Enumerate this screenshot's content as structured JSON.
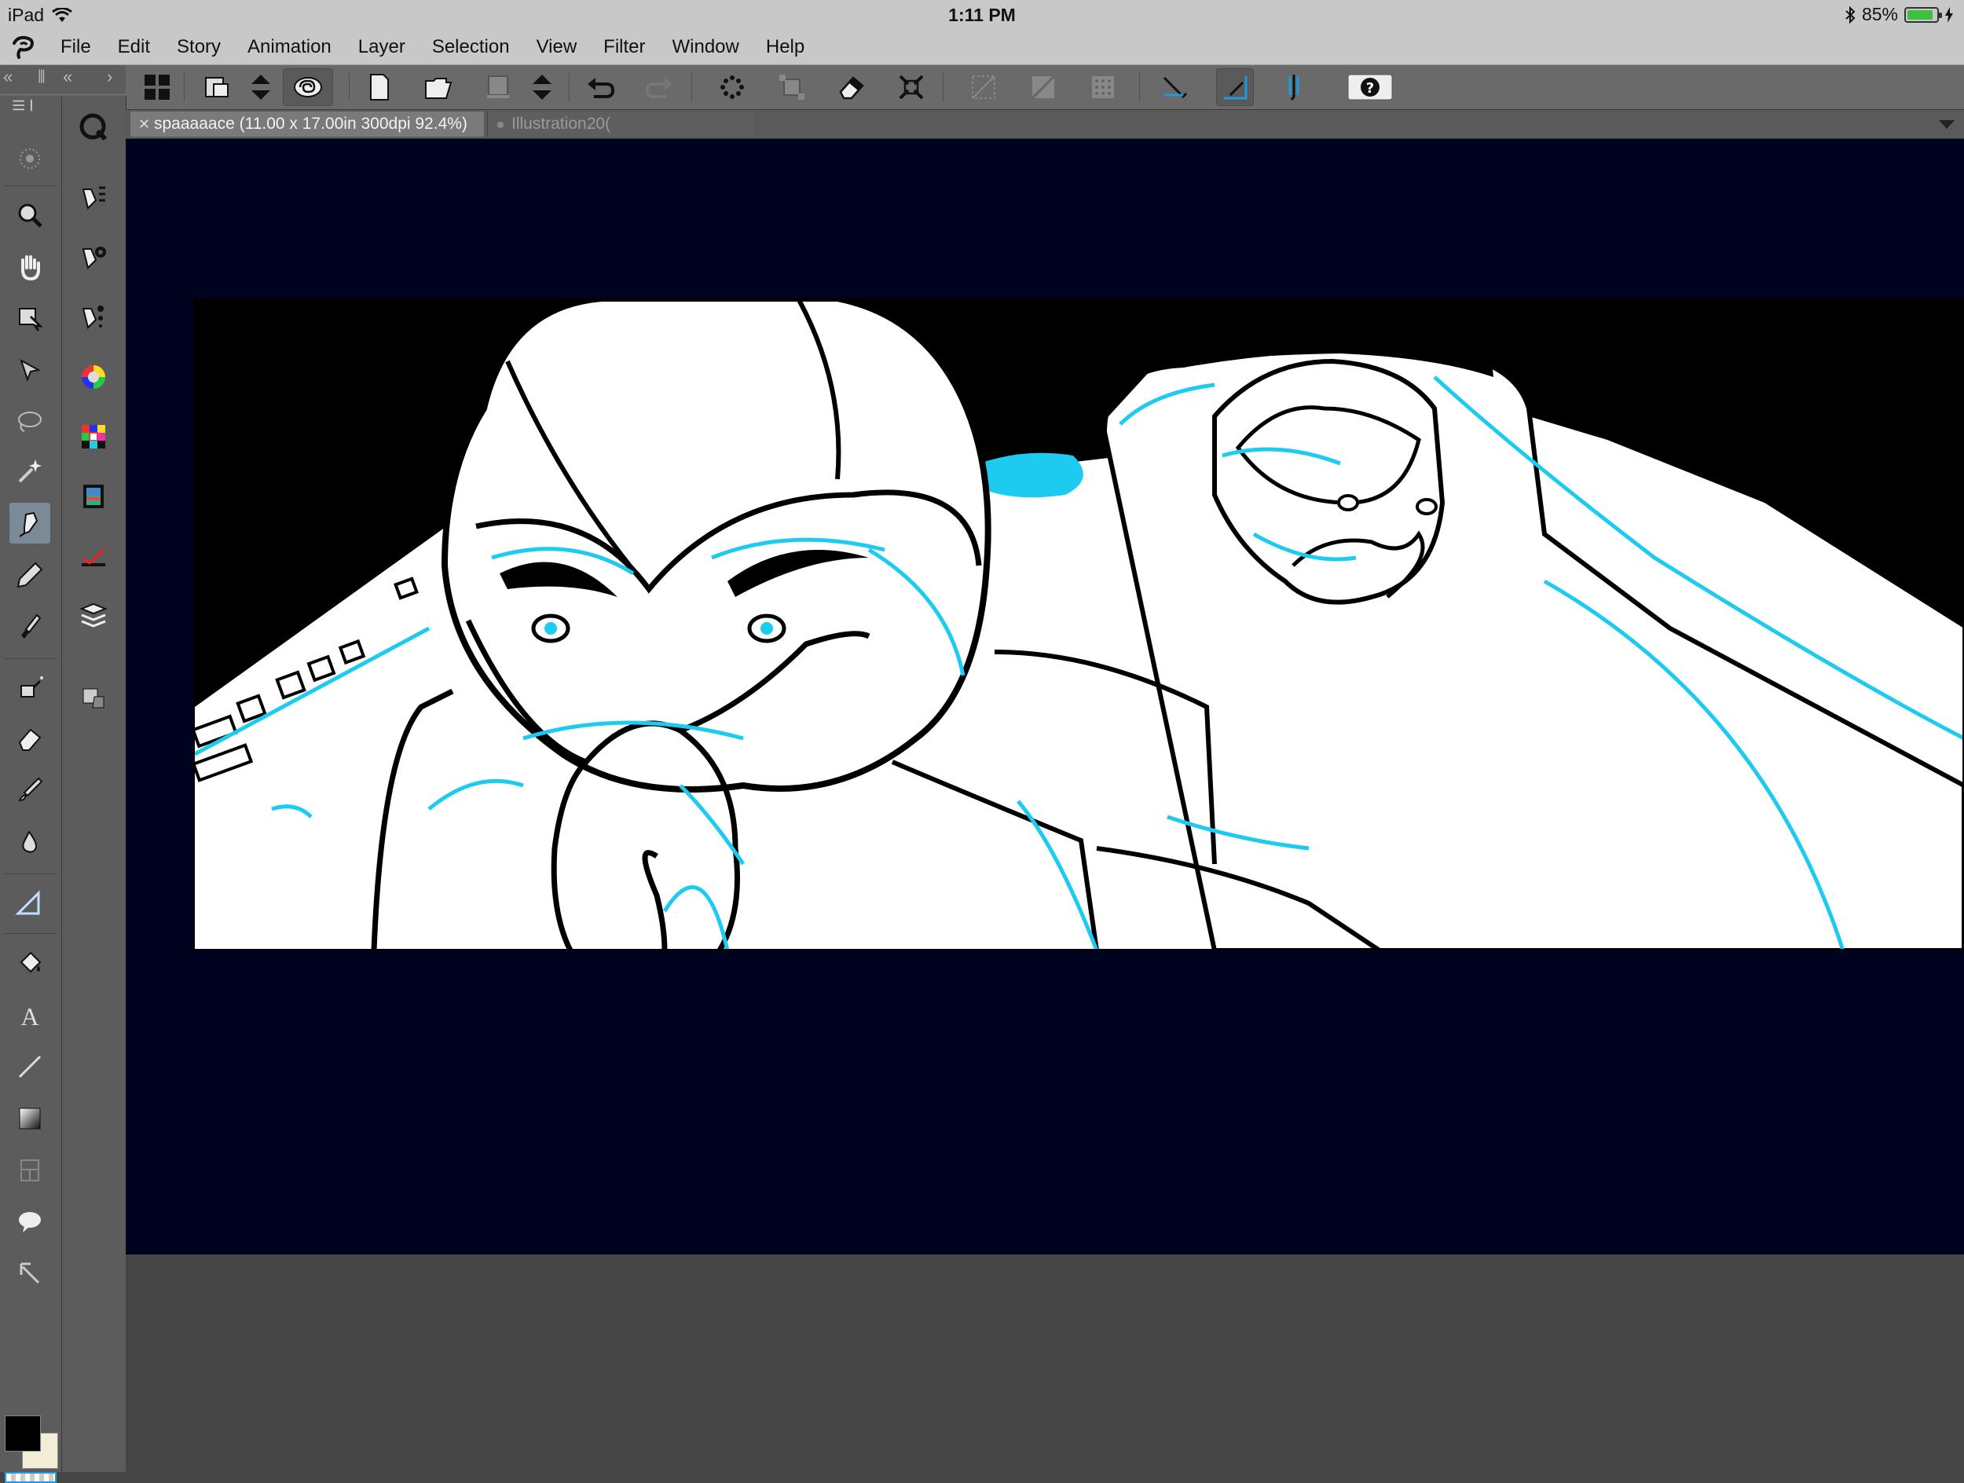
{
  "status_bar": {
    "device": "iPad",
    "time": "1:11 PM",
    "battery": "85%",
    "battery_level": 0.85
  },
  "menu": {
    "items": [
      "File",
      "Edit",
      "Story",
      "Animation",
      "Layer",
      "Selection",
      "View",
      "Filter",
      "Window",
      "Help"
    ]
  },
  "tabs": {
    "active": "spaaaaace (11.00 x 17.00in 300dpi 92.4%)",
    "inactive": "Illustration20("
  },
  "colors": {
    "canvas_bg": "#00031f",
    "accent_line": "#1ecbf0",
    "main_color": "#000000",
    "sub_color": "#f3ecd6"
  },
  "toolbar_icons": [
    "grid-icon",
    "save-as-icon",
    "up-down-icon",
    "swirl-icon",
    "new-doc-icon",
    "open-folder-icon",
    "layer-icon",
    "up-down-icon",
    "undo-icon",
    "redo-icon",
    "spray-icon",
    "transform-icon",
    "eraser-icon",
    "fit-icon",
    "snap-off-icon",
    "snap-grid-icon",
    "snap-dot-icon",
    "ruler-snap-icon",
    "perspective-snap-icon",
    "pen-snap-icon",
    "help-icon"
  ]
}
